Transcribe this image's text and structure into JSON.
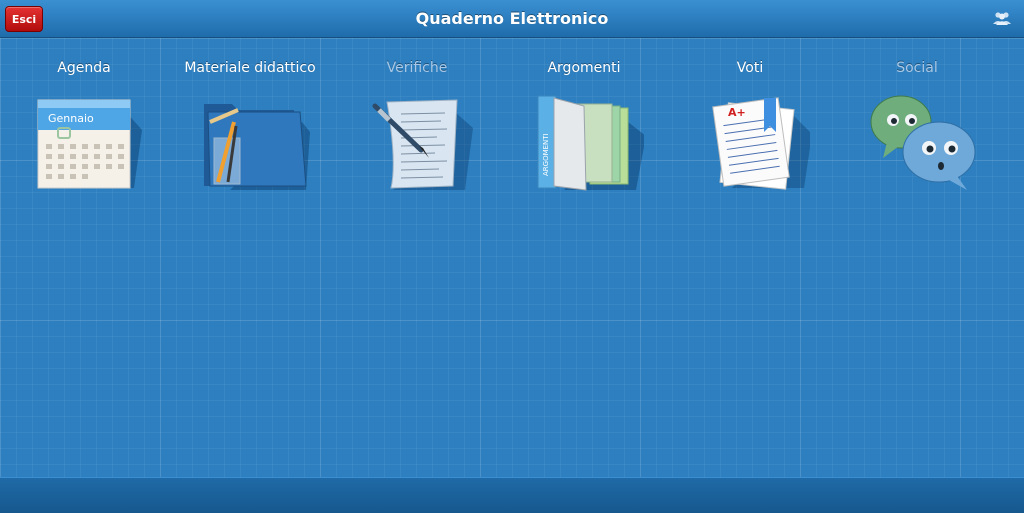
{
  "header": {
    "title": "Quaderno Elettronico",
    "exit_label": "Esci",
    "users_icon": "users-icon"
  },
  "tiles": [
    {
      "label": "Agenda",
      "icon": "calendar-icon",
      "enabled": true,
      "calendar_month": "Gennaio"
    },
    {
      "label": "Materiale didattico",
      "icon": "folder-pencils-icon",
      "enabled": true
    },
    {
      "label": "Verifiche",
      "icon": "document-pen-icon",
      "enabled": false
    },
    {
      "label": "Argomenti",
      "icon": "file-folders-icon",
      "enabled": true,
      "folder_spine_text": "ARGOMENTI"
    },
    {
      "label": "Voti",
      "icon": "graded-paper-icon",
      "enabled": true,
      "grade_mark": "A+"
    },
    {
      "label": "Social",
      "icon": "chat-bubbles-icon",
      "enabled": false
    }
  ],
  "colors": {
    "background": "#2d7fc0",
    "header": "#1f6cab",
    "exit_button": "#c41414",
    "disabled_label": "#a8c8e6"
  }
}
